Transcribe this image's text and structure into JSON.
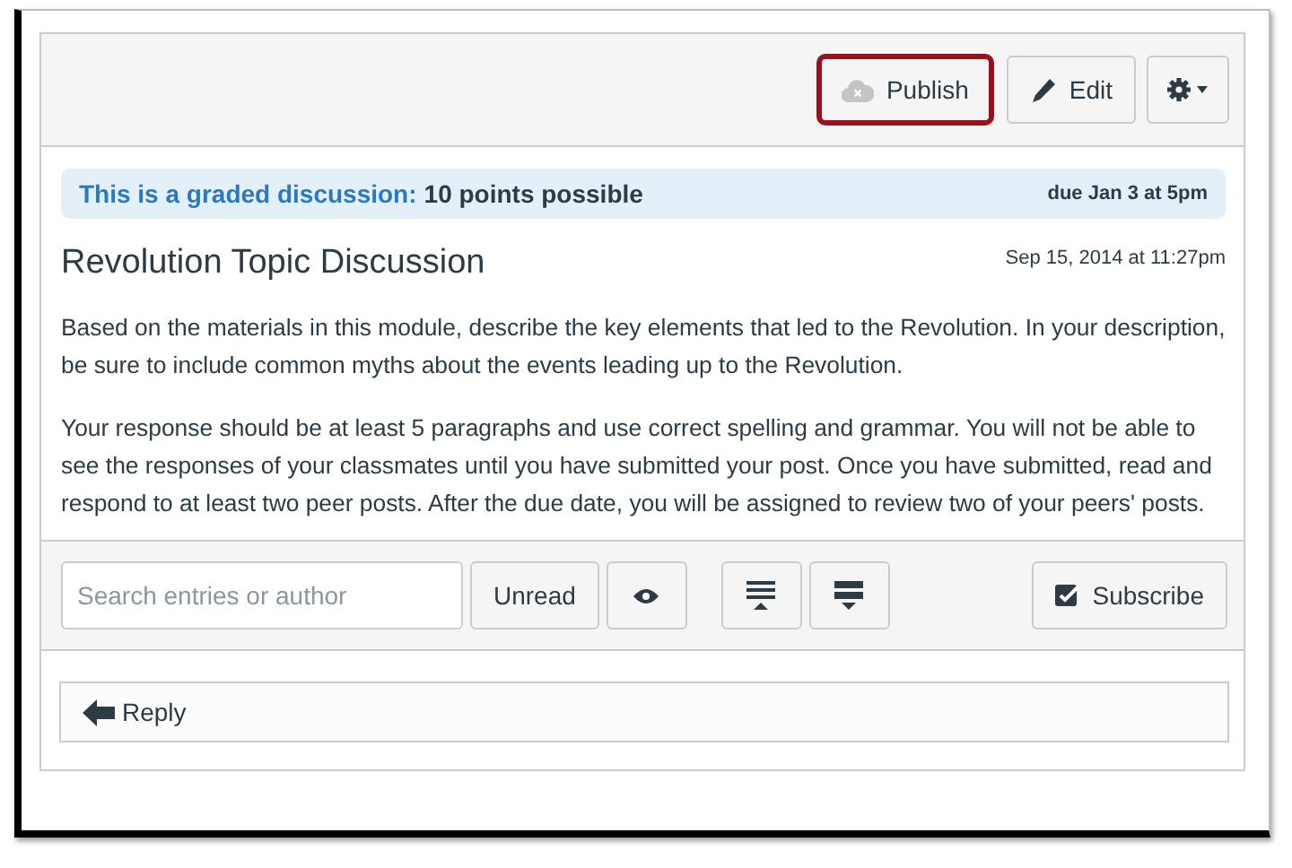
{
  "header_buttons": [
    {
      "kind": "publish",
      "label": "Publish",
      "highlighted": true
    },
    {
      "kind": "edit",
      "label": "Edit",
      "highlighted": false
    },
    {
      "kind": "settings",
      "highlighted": false
    }
  ],
  "graded_banner": {
    "lead": "This is a graded discussion:",
    "points": "10 points possible",
    "due": "due Jan 3 at 5pm"
  },
  "title": "Revolution Topic Discussion",
  "posted": "Sep 15, 2014 at 11:27pm",
  "paragraphs": [
    "Based on the materials in this module, describe the key elements that led to the Revolution. In your description, be sure to include common myths about the events leading up to the Revolution.",
    "Your response should be at least 5 paragraphs and use correct spelling and grammar. You will not be able to see the responses of your classmates until you have submitted your post. Once you have submitted, read and respond to at least two peer posts. After the due date, you will be assigned to review two of your peers' posts."
  ],
  "toolbar": {
    "search": {
      "placeholder": "Search entries or author"
    },
    "unread_button": "Unread",
    "subscribe_button": "Subscribe"
  },
  "reply_button": "Reply"
}
